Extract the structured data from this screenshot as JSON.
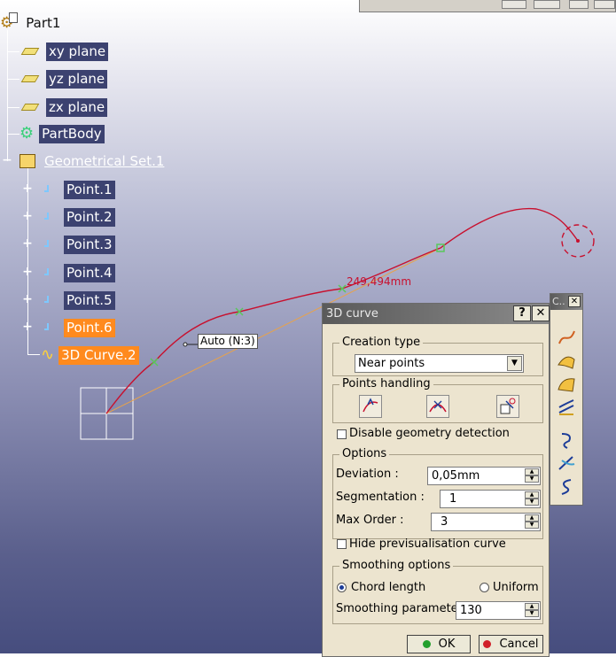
{
  "tree": {
    "root": "Part1",
    "items": [
      {
        "label": "xy plane"
      },
      {
        "label": "yz plane"
      },
      {
        "label": "zx plane"
      },
      {
        "label": "PartBody"
      },
      {
        "label": "Geometrical Set.1"
      }
    ],
    "children": [
      {
        "label": "Point.1"
      },
      {
        "label": "Point.2"
      },
      {
        "label": "Point.3"
      },
      {
        "label": "Point.4"
      },
      {
        "label": "Point.5"
      },
      {
        "label": "Point.6"
      },
      {
        "label": "3D Curve.2"
      }
    ]
  },
  "viewport": {
    "dimension_label": "249,494mm",
    "auto_label": "Auto (N:3)"
  },
  "dialog": {
    "title": "3D curve",
    "help_button": "?",
    "close_button": "✕",
    "creation_type": {
      "label": "Creation type",
      "value": "Near points"
    },
    "points_handling": {
      "label": "Points handling"
    },
    "disable_geometry_detection": {
      "label": "Disable geometry detection",
      "checked": false
    },
    "options": {
      "label": "Options",
      "deviation_label": "Deviation :",
      "deviation_value": "0,05mm",
      "segmentation_label": "Segmentation :",
      "segmentation_value": "1",
      "max_order_label": "Max Order :",
      "max_order_value": "3"
    },
    "hide_previsualisation": {
      "label": "Hide previsualisation curve",
      "checked": false
    },
    "smoothing": {
      "label": "Smoothing options",
      "chord_length": "Chord length",
      "uniform": "Uniform",
      "selected": "Chord length",
      "parameter_label": "Smoothing parameter",
      "parameter_value": "130"
    },
    "ok_button": "OK",
    "cancel_button": "Cancel"
  },
  "side_toolbar": {
    "title": "C..",
    "close": "✕"
  },
  "colors": {
    "selection": "#ff8a1e",
    "curve": "#c8102e",
    "point": "#58c85a"
  }
}
